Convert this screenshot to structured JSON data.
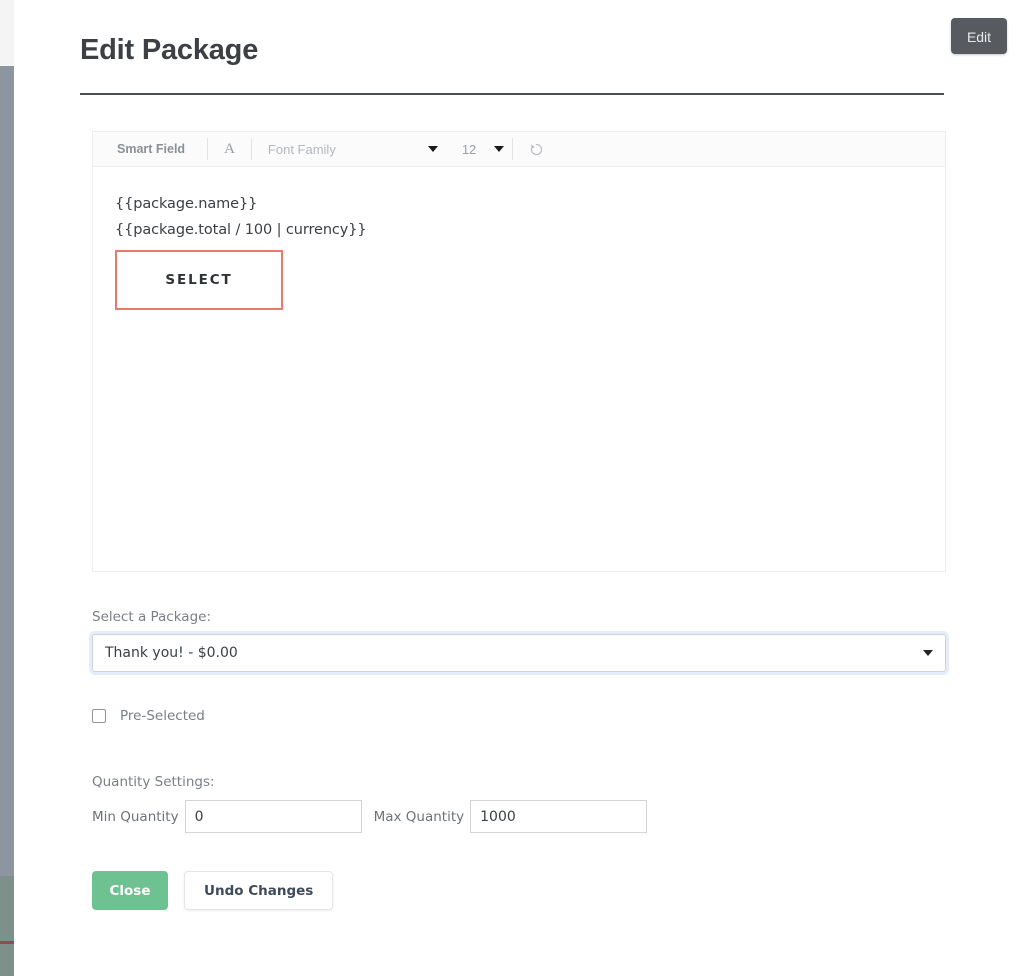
{
  "window": {
    "title": "Edit Package"
  },
  "header": {
    "title": "Edit Package",
    "edit_button_label": "Edit"
  },
  "editor": {
    "toolbar": {
      "smart_field_label": "Smart Field",
      "font_style_glyph": "A",
      "font_family_label": "Font Family",
      "font_size_value": "12",
      "undo_icon_name": "undo-arrow-icon"
    },
    "content_lines": [
      "{{package.name}}",
      "{{package.total / 100 | currency}}"
    ],
    "select_button_label": "SELECT",
    "select_button_border_color": "#e8796b"
  },
  "package_field": {
    "label": "Select a Package:",
    "selected_value": "Thank you! - $0.00"
  },
  "preselected": {
    "label": "Pre-Selected",
    "checked": false
  },
  "quantity": {
    "section_label": "Quantity Settings:",
    "min_caption": "Min Quantity",
    "min_value": "0",
    "max_caption": "Max Quantity",
    "max_value": "1000"
  },
  "footer": {
    "close_label": "Close",
    "undo_changes_label": "Undo Changes"
  },
  "colors": {
    "accent_green": "#6ec292",
    "edit_button": "#575a5e",
    "select_outline": "#e8796b",
    "background_nav": "#8d96a0",
    "background_panel": "#7e908a"
  }
}
